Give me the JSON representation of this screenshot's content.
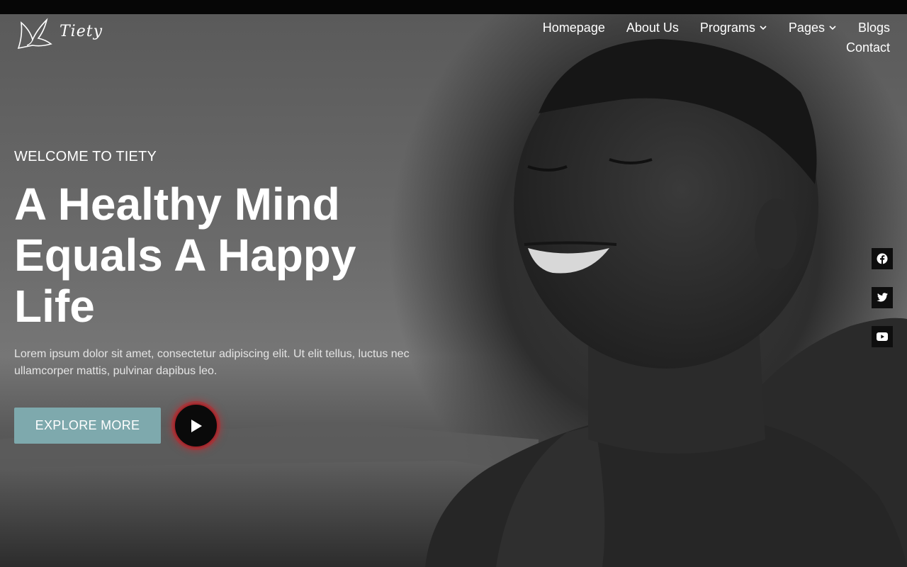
{
  "brand": {
    "name": "Tiety"
  },
  "nav": {
    "items": [
      {
        "label": "Homepage",
        "has_dropdown": false
      },
      {
        "label": "About Us",
        "has_dropdown": false
      },
      {
        "label": "Programs",
        "has_dropdown": true
      },
      {
        "label": "Pages",
        "has_dropdown": true
      },
      {
        "label": "Blogs",
        "has_dropdown": false
      },
      {
        "label": "Contact",
        "has_dropdown": false
      }
    ]
  },
  "hero": {
    "eyebrow": "WELCOME TO TIETY",
    "headline_line1": "A Healthy Mind",
    "headline_line2": "Equals A Happy",
    "headline_line3": "Life",
    "description": "Lorem ipsum dolor sit amet, consectetur adipiscing elit. Ut elit tellus, luctus nec ullamcorper mattis, pulvinar dapibus leo.",
    "cta_label": "EXPLORE MORE"
  },
  "social": [
    "facebook-icon",
    "twitter-icon",
    "youtube-icon"
  ],
  "colors": {
    "accent": "#7ea9ad",
    "play_ring": "#a3262b",
    "topbar": "#060606"
  }
}
